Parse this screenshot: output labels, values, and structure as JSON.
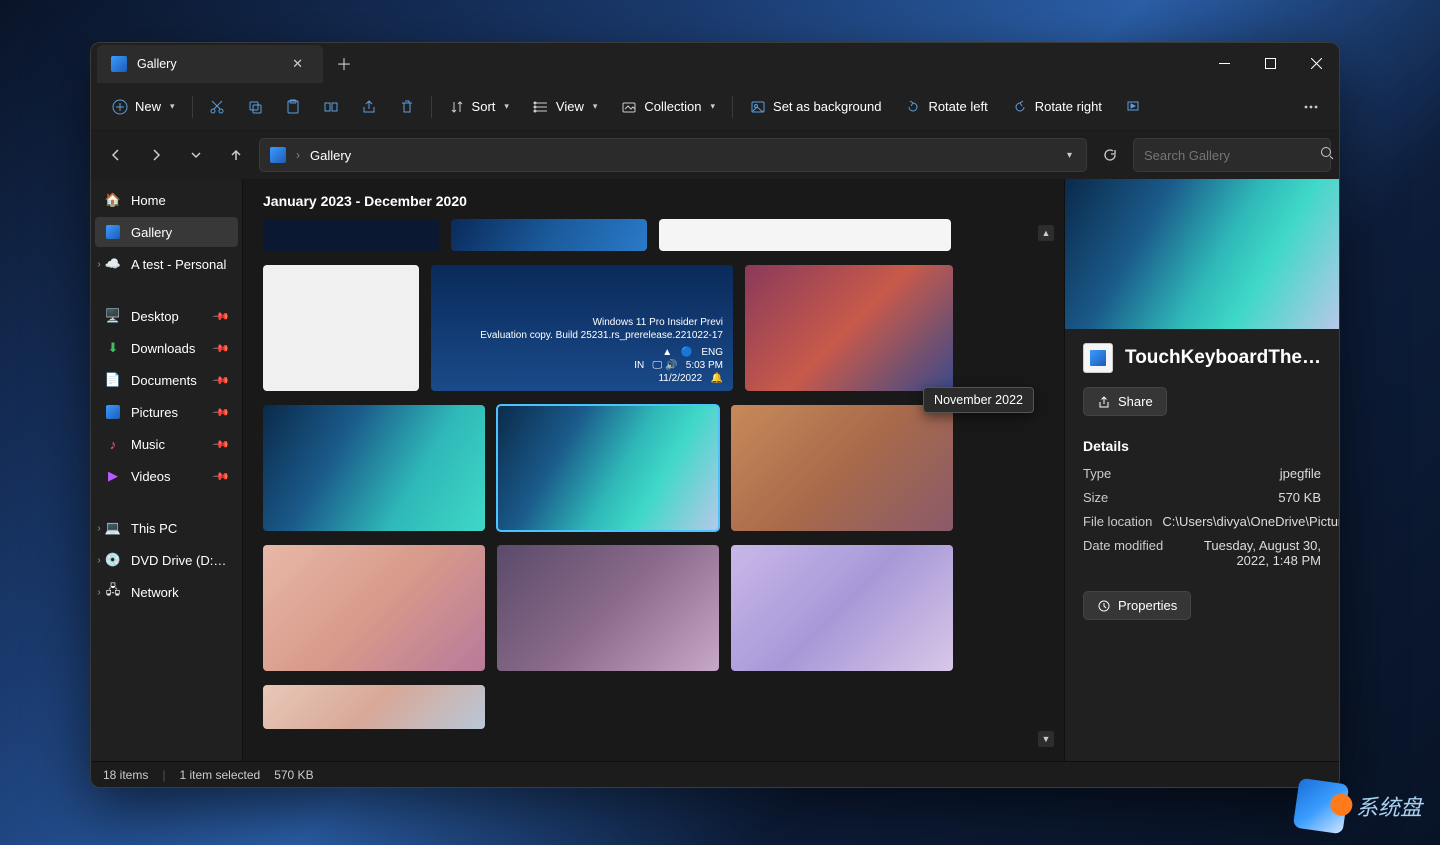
{
  "tab": {
    "title": "Gallery"
  },
  "toolbar": {
    "new": "New",
    "sort": "Sort",
    "view": "View",
    "collection": "Collection",
    "set_bg": "Set as background",
    "rotate_left": "Rotate left",
    "rotate_right": "Rotate right"
  },
  "breadcrumb": {
    "root": "Gallery"
  },
  "search": {
    "placeholder": "Search Gallery"
  },
  "sidebar": {
    "home": "Home",
    "gallery": "Gallery",
    "atest": "A test - Personal",
    "desktop": "Desktop",
    "downloads": "Downloads",
    "documents": "Documents",
    "pictures": "Pictures",
    "music": "Music",
    "videos": "Videos",
    "thispc": "This PC",
    "dvd": "DVD Drive (D:) CCC",
    "network": "Network"
  },
  "content": {
    "heading": "January 2023 - December 2020",
    "tooltip": "November 2022"
  },
  "details": {
    "filename": "TouchKeyboardThe…",
    "share": "Share",
    "section": "Details",
    "type_k": "Type",
    "type_v": "jpegfile",
    "size_k": "Size",
    "size_v": "570 KB",
    "loc_k": "File location",
    "loc_v": "C:\\Users\\divya\\OneDrive\\Pictures",
    "mod_k": "Date modified",
    "mod_v": "Tuesday, August 30, 2022, 1:48 PM",
    "properties": "Properties"
  },
  "status": {
    "items": "18 items",
    "selected": "1 item selected",
    "size": "570 KB"
  },
  "watermark": "系统盘"
}
